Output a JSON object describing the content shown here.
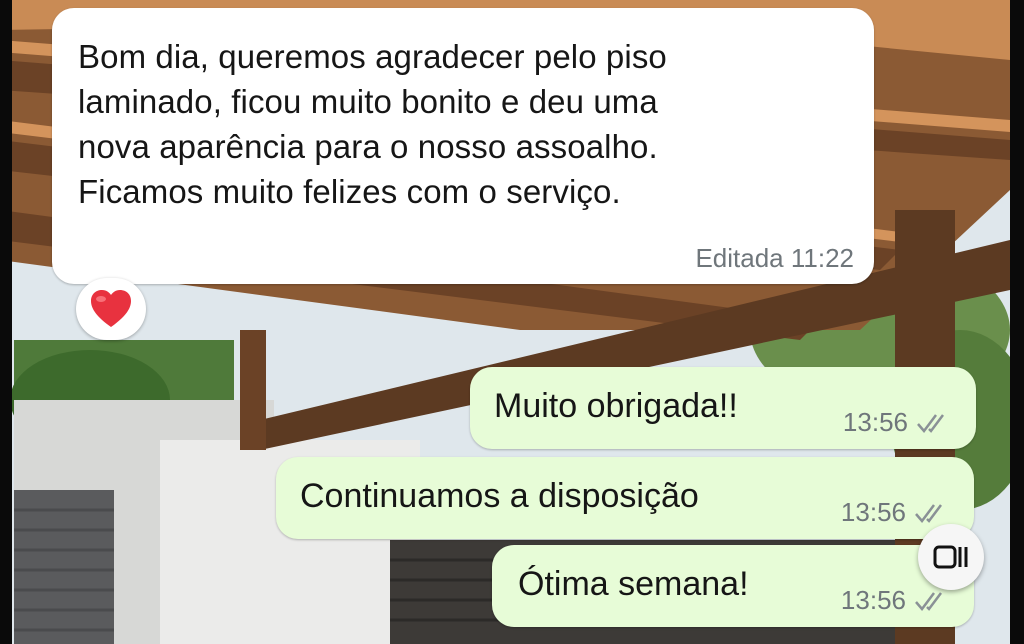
{
  "chat": {
    "incoming": {
      "text": "Bom dia, queremos agradecer pelo piso\nlaminado, ficou muito bonito e deu uma\nnova aparência para o nosso assoalho.\nFicamos muito felizes com o serviço.",
      "meta": "Editada 11:22",
      "reaction": "heart"
    },
    "outgoing": [
      {
        "text": "Muito obrigada!!",
        "time": "13:56",
        "status": "read"
      },
      {
        "text": "Continuamos a disposição",
        "time": "13:56",
        "status": "read"
      },
      {
        "text": "Ótima semana!",
        "time": "13:56",
        "status": "read"
      }
    ]
  },
  "icons": {
    "reaction": "heart-icon",
    "ticks": "double-check-icon",
    "floating": "recent-apps-icon"
  },
  "colors": {
    "incoming_bubble": "#ffffff",
    "outgoing_bubble": "#e7fcd7",
    "meta_text": "#6f767b",
    "heart": "#e8323f"
  }
}
